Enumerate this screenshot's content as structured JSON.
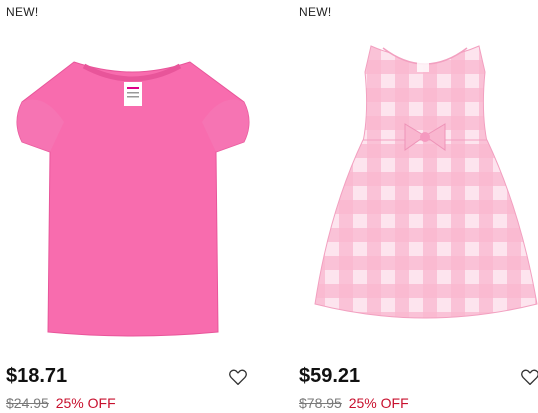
{
  "products": [
    {
      "badge": "NEW!",
      "image_icon": "pink-tshirt-icon",
      "price": "$18.71",
      "original_price": "$24.95",
      "discount": "25% OFF",
      "favorite_icon": "heart-outline-icon"
    },
    {
      "badge": "NEW!",
      "image_icon": "pink-gingham-dress-icon",
      "price": "$59.21",
      "original_price": "$78.95",
      "discount": "25% OFF",
      "favorite_icon": "heart-outline-icon"
    }
  ],
  "colors": {
    "sale": "#c8102e",
    "shirt_pink": "#f86cae",
    "dress_pink": "#f7a9c8"
  }
}
